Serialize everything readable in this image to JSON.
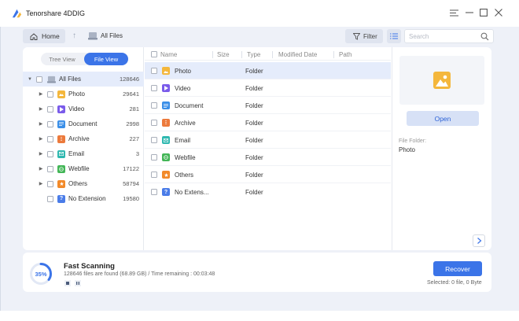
{
  "app": {
    "title": "Tenorshare 4DDIG"
  },
  "toolbar": {
    "home_label": "Home",
    "breadcrumb": "All Files",
    "filter_label": "Filter",
    "search_placeholder": "Search"
  },
  "view_toggle": {
    "tree": "Tree View",
    "file": "File View",
    "active": "file"
  },
  "tree": {
    "root": {
      "label": "All Files",
      "count": "128646"
    },
    "items": [
      {
        "label": "Photo",
        "count": "29641",
        "icon": "photo-icon",
        "color": "#f4b73c"
      },
      {
        "label": "Video",
        "count": "281",
        "icon": "video-icon",
        "color": "#7a5bea"
      },
      {
        "label": "Document",
        "count": "2998",
        "icon": "document-icon",
        "color": "#3b8fe8"
      },
      {
        "label": "Archive",
        "count": "227",
        "icon": "archive-icon",
        "color": "#ec7a3c"
      },
      {
        "label": "Email",
        "count": "3",
        "icon": "email-icon",
        "color": "#2fb8b0"
      },
      {
        "label": "Webfile",
        "count": "17122",
        "icon": "webfile-icon",
        "color": "#43b657"
      },
      {
        "label": "Others",
        "count": "58794",
        "icon": "others-icon",
        "color": "#f28a2a"
      },
      {
        "label": "No Extension",
        "count": "19580",
        "icon": "no-extension-icon",
        "color": "#4a7ce8"
      }
    ]
  },
  "file_list": {
    "columns": [
      "Name",
      "Size",
      "Type",
      "Modified Date",
      "Path"
    ],
    "rows": [
      {
        "name": "Photo",
        "type": "Folder",
        "icon": "photo-icon",
        "color": "#f4b73c"
      },
      {
        "name": "Video",
        "type": "Folder",
        "icon": "video-icon",
        "color": "#7a5bea"
      },
      {
        "name": "Document",
        "type": "Folder",
        "icon": "document-icon",
        "color": "#3b8fe8"
      },
      {
        "name": "Archive",
        "type": "Folder",
        "icon": "archive-icon",
        "color": "#ec7a3c"
      },
      {
        "name": "Email",
        "type": "Folder",
        "icon": "email-icon",
        "color": "#2fb8b0"
      },
      {
        "name": "Webfile",
        "type": "Folder",
        "icon": "webfile-icon",
        "color": "#43b657"
      },
      {
        "name": "Others",
        "type": "Folder",
        "icon": "others-icon",
        "color": "#f28a2a"
      },
      {
        "name": "No Extens...",
        "type": "Folder",
        "icon": "no-extension-icon",
        "color": "#4a7ce8"
      }
    ]
  },
  "preview": {
    "open_label": "Open",
    "file_folder_label": "File Folder:",
    "file_folder_value": "Photo"
  },
  "scan": {
    "progress_label": "35%",
    "progress_fraction": 0.35,
    "title": "Fast Scanning",
    "stats": "128646 files are found (68.89 GB) /  Time remaining : 00:03:48"
  },
  "actions": {
    "recover_label": "Recover",
    "selected_info": "Selected: 0 file, 0 Byte"
  },
  "colors": {
    "accent": "#3b74e8",
    "selected_row": "#e5ecfb"
  }
}
